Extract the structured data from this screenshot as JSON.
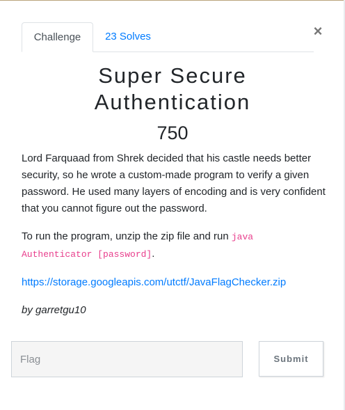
{
  "tabs": {
    "challenge_label": "Challenge",
    "solves_label": "23 Solves"
  },
  "close_label": "×",
  "challenge": {
    "name_line1": "Super Secure",
    "name_line2": "Authentication",
    "points": "750",
    "description_1": "Lord Farquaad from Shrek decided that his castle needs better security, so he wrote a custom-made program to verify a given password. He used many layers of encoding and is very confident that you cannot figure out the password.",
    "run_text": "To run the program, unzip the zip file and run ",
    "run_code": "java Authenticator [password]",
    "run_suffix": ".",
    "file_link": "https://storage.googleapis.com/utctf/JavaFlagChecker.zip",
    "author": "by garretgu10"
  },
  "form": {
    "flag_placeholder": "Flag",
    "flag_value": "",
    "submit_label": "Submit"
  },
  "colors": {
    "link": "#007bff",
    "code": "#e83e8c",
    "input_bg": "#f5f5f5"
  }
}
